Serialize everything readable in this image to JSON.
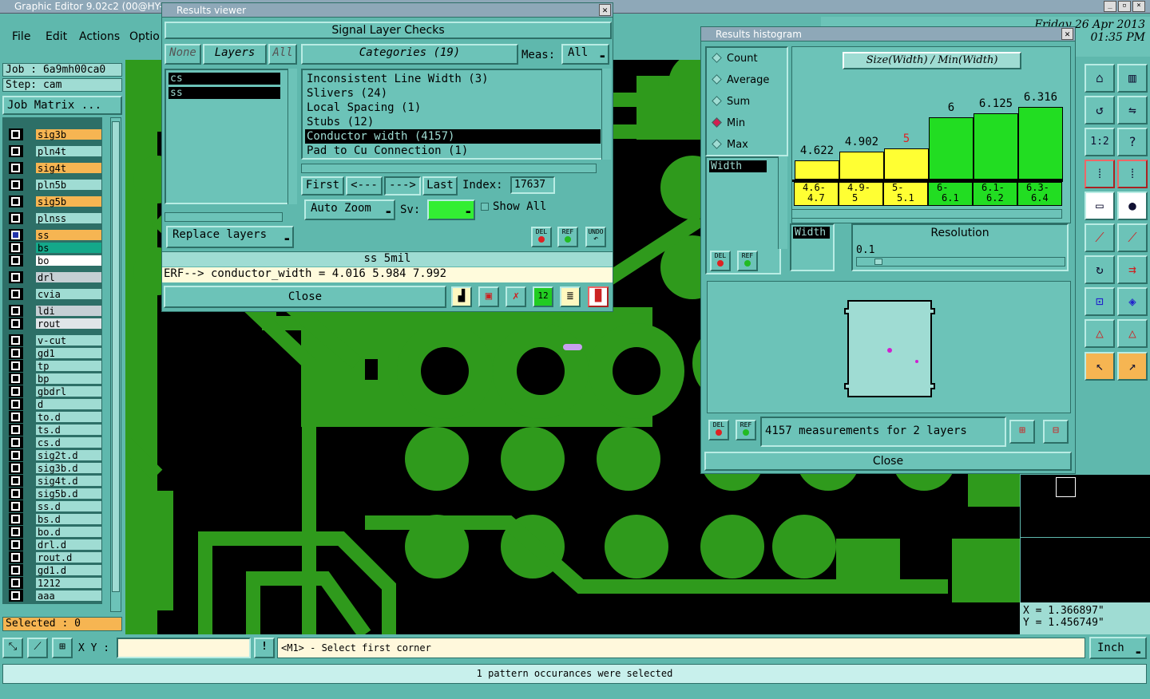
{
  "app": {
    "title": "Graphic Editor 9.02c2 (00@HY-H",
    "menu": [
      "File",
      "Edit",
      "Actions",
      "Optio"
    ],
    "datetime": [
      "Friday 26 Apr 2013",
      "01:35 PM"
    ]
  },
  "left": {
    "job": "Job : 6a9mh00ca0",
    "step": "Step: cam",
    "job_matrix": "Job Matrix ...",
    "selected": "Selected : 0",
    "layers": [
      {
        "name": "sig3b",
        "color": "#f6b552"
      },
      {
        "name": "pln4t",
        "color": "#9fdcd3"
      },
      {
        "name": "sig4t",
        "color": "#f6b552"
      },
      {
        "name": "pln5b",
        "color": "#9fdcd3"
      },
      {
        "name": "sig5b",
        "color": "#f6b552"
      },
      {
        "name": "plnss",
        "color": "#9fdcd3"
      },
      {
        "name": "ss",
        "color": "#f6b552"
      },
      {
        "name": "bs",
        "color": "#14a88a"
      },
      {
        "name": "bo",
        "color": "#ffffff"
      },
      {
        "name": "drl",
        "color": "#c5cfd4"
      },
      {
        "name": "cvia",
        "color": "#9fdcd3"
      },
      {
        "name": "ldi",
        "color": "#c5cfd4"
      },
      {
        "name": "rout",
        "color": "#dfe5e8"
      },
      {
        "name": "v-cut",
        "color": "#9fdcd3"
      },
      {
        "name": "gd1",
        "color": "#9fdcd3"
      },
      {
        "name": "tp",
        "color": "#9fdcd3"
      },
      {
        "name": "bp",
        "color": "#9fdcd3"
      },
      {
        "name": "gbdrl",
        "color": "#9fdcd3"
      },
      {
        "name": "d",
        "color": "#9fdcd3"
      },
      {
        "name": "to.d",
        "color": "#9fdcd3"
      },
      {
        "name": "ts.d",
        "color": "#9fdcd3"
      },
      {
        "name": "cs.d",
        "color": "#9fdcd3"
      },
      {
        "name": "sig2t.d",
        "color": "#9fdcd3"
      },
      {
        "name": "sig3b.d",
        "color": "#9fdcd3"
      },
      {
        "name": "sig4t.d",
        "color": "#9fdcd3"
      },
      {
        "name": "sig5b.d",
        "color": "#9fdcd3"
      },
      {
        "name": "ss.d",
        "color": "#9fdcd3"
      },
      {
        "name": "bs.d",
        "color": "#9fdcd3"
      },
      {
        "name": "bo.d",
        "color": "#9fdcd3"
      },
      {
        "name": "drl.d",
        "color": "#9fdcd3"
      },
      {
        "name": "rout.d",
        "color": "#9fdcd3"
      },
      {
        "name": "gd1.d",
        "color": "#9fdcd3"
      },
      {
        "name": "1212",
        "color": "#9fdcd3"
      },
      {
        "name": "aaa",
        "color": "#9fdcd3"
      }
    ]
  },
  "results_viewer": {
    "title": "Results viewer",
    "heading": "Signal Layer Checks",
    "none_btn": "None",
    "layers_btn": "Layers",
    "all_btn": "All",
    "categories_btn": "Categories (19)",
    "meas_label": "Meas:",
    "meas_value": "All",
    "layers": [
      "cs",
      "ss"
    ],
    "categories": [
      "Inconsistent Line Width (3)",
      "Slivers (24)",
      "Local Spacing (1)",
      "Stubs (12)",
      "Conductor width (4157)",
      "Pad to Cu Connection (1)"
    ],
    "first": "First",
    "prev": "<---",
    "next": "--->",
    "last": "Last",
    "index_label": "Index:",
    "index_value": "17637",
    "auto_zoom": "Auto Zoom",
    "sv_label": "Sv:",
    "show_all": "Show All",
    "replace_layers": "Replace layers",
    "status": "ss 5mil",
    "erf": "ERF--> conductor_width = 4.016 5.984 7.992",
    "close": "Close",
    "del": "DEL",
    "ref": "REF",
    "undo": "UNDO"
  },
  "histogram": {
    "title": "Results histogram",
    "radios": [
      "Count",
      "Average",
      "Sum",
      "Min",
      "Max"
    ],
    "selected_radio": "Min",
    "measure_list": [
      "Width"
    ],
    "chart_title": "Size(Width) / Min(Width)",
    "resolution_label": "Resolution",
    "resolution_value": "0.1",
    "width_tag": "Width",
    "summary": "4157 measurements for 2 layers",
    "close": "Close",
    "del": "DEL",
    "ref": "REF"
  },
  "chart_data": {
    "type": "bar",
    "title": "Size(Width) / Min(Width)",
    "categories": [
      "4.6-4.7",
      "4.9-5",
      "5-5.1",
      "6-6.1",
      "6.1-6.2",
      "6.3-6.4"
    ],
    "values": [
      4.622,
      4.902,
      5,
      6,
      6.125,
      6.316
    ],
    "value_labels": [
      "4.622",
      "4.902",
      "5",
      "6",
      "6.125",
      "6.316"
    ],
    "bin_labels_top": [
      "4.6-",
      "4.9-",
      "5-",
      "6-",
      "6.1-",
      "6.3-"
    ],
    "bin_labels_bottom": [
      "4.7",
      "5",
      "5.1",
      "6.1",
      "6.2",
      "6.4"
    ],
    "colors": [
      "#ffff33",
      "#ffff33",
      "#ffff33",
      "#22dd22",
      "#22dd22",
      "#22dd22"
    ],
    "highlight_label_color": "#dd2222",
    "highlight_index": 2
  },
  "statusbar": {
    "xy_label": "X Y :",
    "prompt": "<M1> - Select first corner",
    "units": "Inch",
    "message": "1 pattern occurances were selected",
    "coord_x": "X = 1.366897\"",
    "coord_y": "Y = 1.456749\""
  }
}
